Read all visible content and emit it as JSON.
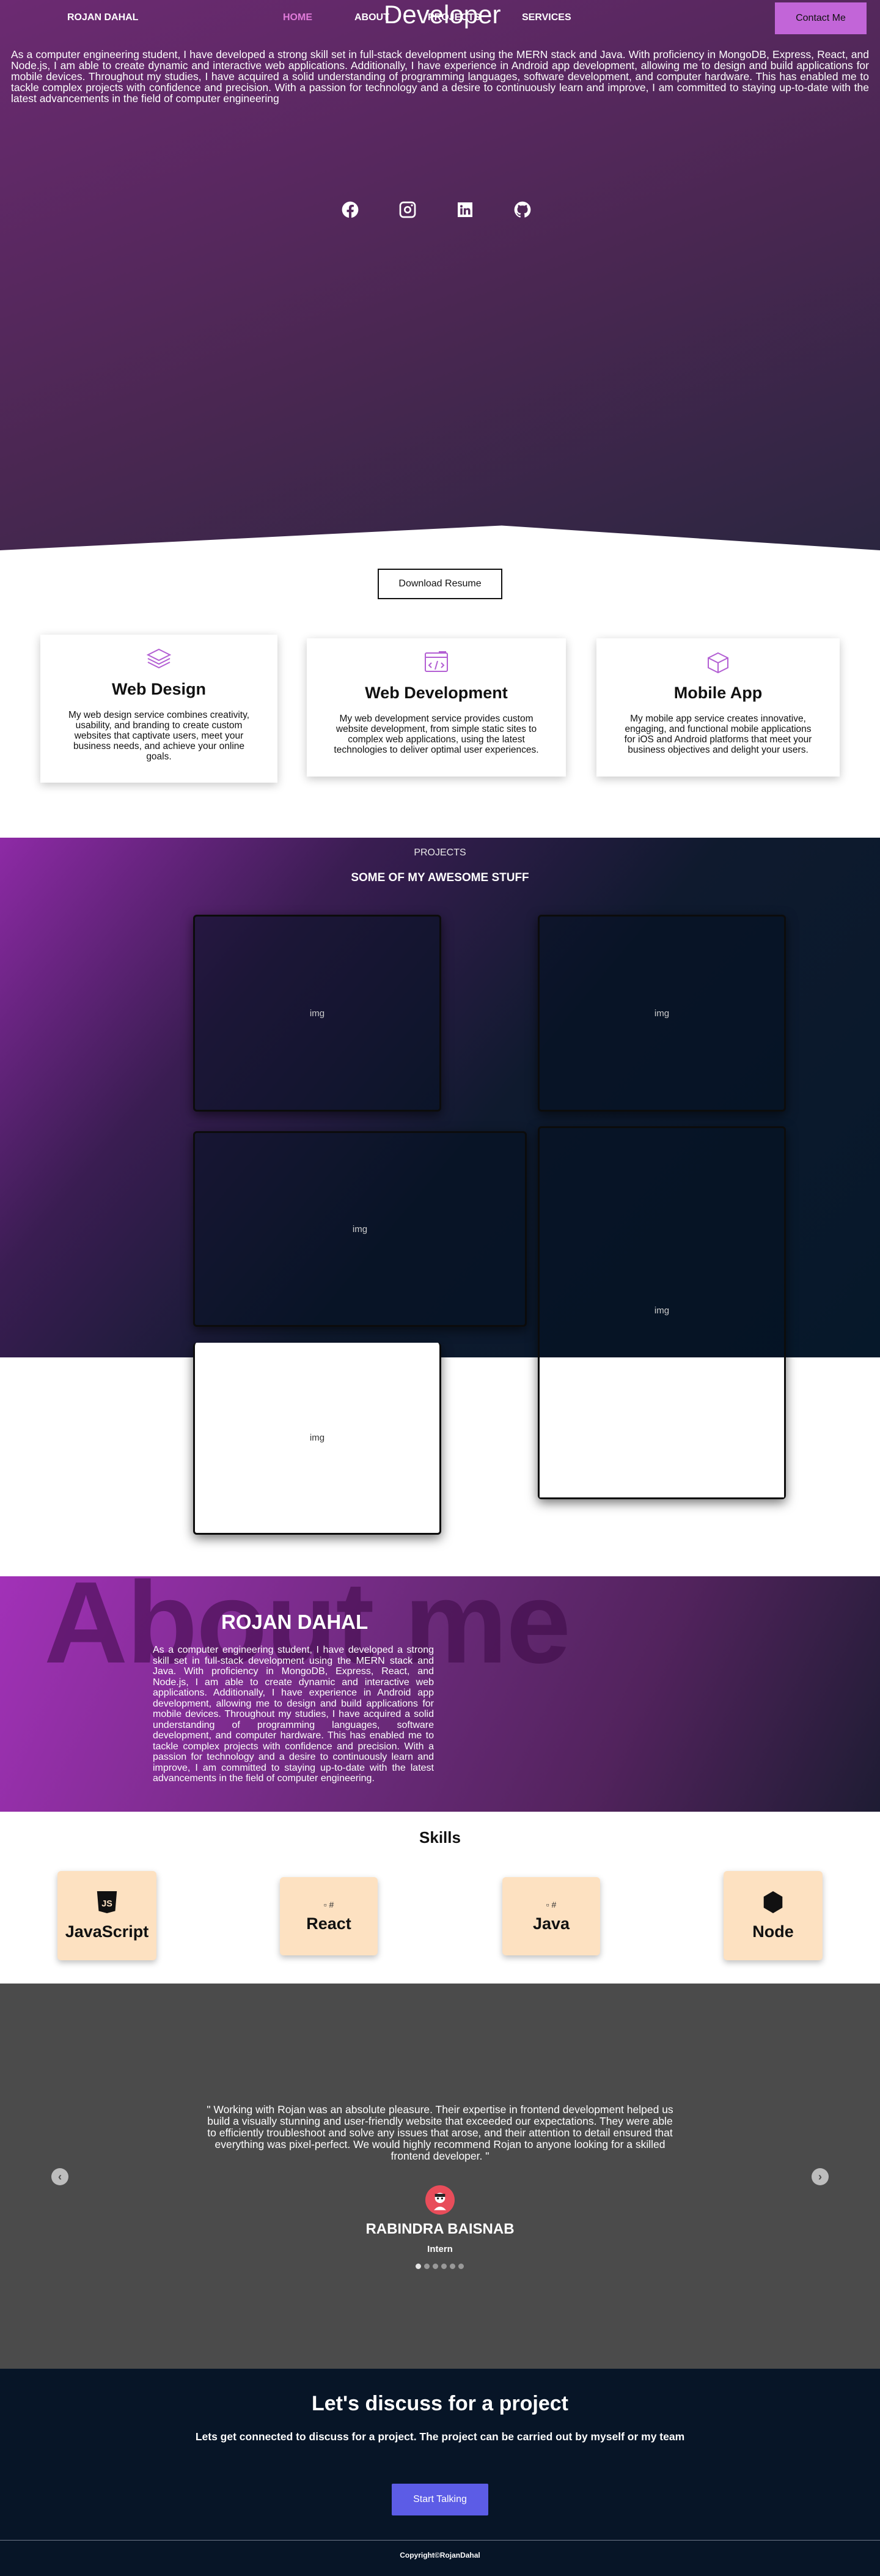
{
  "nav": {
    "brand": "ROJAN DAHAL",
    "links": [
      "HOME",
      "ABOUT",
      "PROJECTS",
      "SERVICES"
    ],
    "hero_title": "Developer",
    "contact": "Contact Me"
  },
  "hero": {
    "text": "As a computer engineering student, I have developed a strong skill set in full-stack development using the MERN stack and Java. With proficiency in MongoDB, Express, React, and Node.js, I am able to create dynamic and interactive web applications. Additionally, I have experience in Android app development, allowing me to design and build applications for mobile devices. Throughout my studies, I have acquired a solid understanding of programming languages, software development, and computer hardware. This has enabled me to tackle complex projects with confidence and precision. With a passion for technology and a desire to continuously learn and improve, I am committed to staying up-to-date with the latest advancements in the field of computer engineering",
    "socials": [
      "facebook-icon",
      "instagram-icon",
      "linkedin-icon",
      "github-icon"
    ]
  },
  "resume": "Download Resume",
  "services": [
    {
      "title": "Web Design",
      "icon": "layers-icon",
      "desc": "My web design service combines creativity, usability, and branding to create custom websites that captivate users, meet your business needs, and achieve your online goals."
    },
    {
      "title": "Web Development",
      "icon": "code-browser-icon",
      "desc": "My web development service provides custom website development, from simple static sites to complex web applications, using the latest technologies to deliver optimal user experiences."
    },
    {
      "title": "Mobile App",
      "icon": "cube-icon",
      "desc": "My mobile app service creates innovative, engaging, and functional mobile applications for iOS and Android platforms that meet your business objectives and delight your users."
    }
  ],
  "projects": {
    "label": "PROJECTS",
    "title": "SOME OF MY AWESOME STUFF",
    "img_alt": "img"
  },
  "about": {
    "ghost": "About me",
    "name": "ROJAN DAHAL",
    "text": "As a computer engineering student, I have developed a strong skill set in full-stack development using the MERN stack and Java. With proficiency in MongoDB, Express, React, and Node.js, I am able to create dynamic and interactive web applications. Additionally, I have experience in Android app development, allowing me to design and build applications for mobile devices. Throughout my studies, I have acquired a solid understanding of programming languages, software development, and computer hardware. This has enabled me to tackle complex projects with confidence and precision. With a passion for technology and a desire to continuously learn and improve, I am committed to staying up-to-date with the latest advancements in the field of computer engineering."
  },
  "skills": {
    "title": "Skills",
    "items": [
      {
        "name": "JavaScript",
        "icon": "javascript-icon",
        "img": ""
      },
      {
        "name": "React",
        "icon": "",
        "img": "#"
      },
      {
        "name": "Java",
        "icon": "",
        "img": "#"
      },
      {
        "name": "Node",
        "icon": "nodejs-hexagon-icon",
        "img": ""
      }
    ]
  },
  "testimonial": {
    "quote": "\" Working with Rojan was an absolute pleasure. Their expertise in frontend development helped us build a visually stunning and user-friendly website that exceeded our expectations. They were able to efficiently troubleshoot and solve any issues that arose, and their attention to detail ensured that everything was pixel-perfect. We would highly recommend Rojan to anyone looking for a skilled frontend developer. \"",
    "name": "RABINDRA BAISNAB",
    "role": "Intern",
    "slides": 6,
    "active": 1
  },
  "cta": {
    "title": "Let's discuss for a project",
    "subtitle": "Lets get connected to discuss for a project. The project can be carried out by myself or my team",
    "button": "Start Talking"
  },
  "footer": {
    "copyright": "Copyright©RojanDahal"
  },
  "colors": {
    "accent": "#c265d8",
    "cta_button": "#5c5ce6",
    "skill_card": "#fde1c1"
  }
}
